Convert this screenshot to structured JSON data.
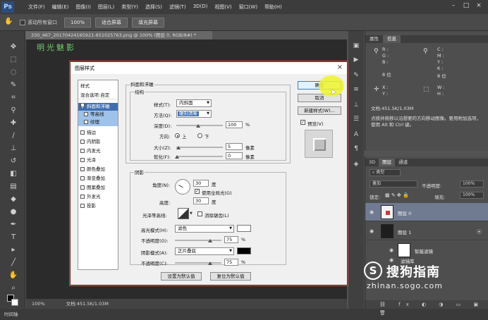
{
  "app": {
    "logo": "Ps"
  },
  "menus": [
    "文件(F)",
    "编辑(E)",
    "图像(I)",
    "图层(L)",
    "类型(Y)",
    "选择(S)",
    "滤镜(T)",
    "3D(D)",
    "视图(V)",
    "窗口(W)",
    "帮助(H)"
  ],
  "options_bar": {
    "scroll_all": "滚动所有窗口",
    "zoom_100": "100%",
    "fit_screen": "适合屏幕",
    "fill_screen": "填充屏幕"
  },
  "document": {
    "tab_title": "330_467_20170424165921-651025763.png @ 100% (图层 0, RGB/8#) *",
    "canvas_text": "明光魅影",
    "zoom": "100%",
    "doc_info": "文档:451.5K/1.03M"
  },
  "bottom": {
    "timeline": "时间轴"
  },
  "info_panel": {
    "tabs": [
      "属性",
      "信息"
    ],
    "r": "R :",
    "g": "G :",
    "b": "B :",
    "c": "C :",
    "m": "M :",
    "y": "Y :",
    "k": "K :",
    "bits_left": "8 位",
    "bits_right": "8 位",
    "x": "X :",
    "y_coord": "Y :",
    "w": "W :",
    "h": "H :",
    "doc_info": "文档:451.5K/1.03M",
    "hint": "点按并拖移以沿想要的方向移动图像。要用附加选项，使用 Alt 和 Ctrl 键。"
  },
  "layers_panel": {
    "tabs": [
      "3D",
      "图层",
      "通道"
    ],
    "kind": "类型",
    "blend_mode": "叠加",
    "opacity_label": "不透明度:",
    "opacity": "100%",
    "lock_label": "锁定:",
    "fill_label": "填充:",
    "fill": "100%",
    "layers": [
      "图层 0",
      "图层 1",
      "智能滤镜",
      "滤镜库"
    ]
  },
  "watermark": {
    "brand": "搜狗指南",
    "url": "zhinan.sogo.com"
  },
  "dialog": {
    "title": "图层样式",
    "close": "×",
    "style_list": {
      "header": "样式",
      "blend_options": "混合选项:自定",
      "items": [
        "斜面和浮雕",
        "等高线",
        "纹理",
        "描边",
        "内阴影",
        "内发光",
        "光泽",
        "颜色叠加",
        "渐变叠加",
        "图案叠加",
        "外发光",
        "投影"
      ]
    },
    "bevel": {
      "section": "斜面和浮雕",
      "structure": "结构",
      "style_label": "样式(T):",
      "style_value": "内斜面",
      "technique_label": "方法(Q):",
      "technique_value": "雕刻清晰",
      "depth_label": "深度(D):",
      "depth_value": "100",
      "depth_unit": "%",
      "direction_label": "方向:",
      "direction_up": "上",
      "direction_down": "下",
      "size_label": "大小(Z):",
      "size_value": "5",
      "size_unit": "像素",
      "soften_label": "软化(F):",
      "soften_value": "0",
      "soften_unit": "像素"
    },
    "shading": {
      "section": "阴影",
      "angle_label": "角度(N):",
      "angle_value": "30",
      "angle_unit": "度",
      "global_light": "使用全局光(G)",
      "altitude_label": "高度:",
      "altitude_value": "30",
      "altitude_unit": "度",
      "gloss_label": "光泽等高线:",
      "anti_alias": "消除锯齿(L)",
      "highlight_mode_label": "高光模式(H):",
      "highlight_mode_value": "滤色",
      "highlight_opacity_label": "不透明度(O):",
      "highlight_opacity": "75",
      "shadow_mode_label": "阴影模式(A):",
      "shadow_mode_value": "正片叠底",
      "shadow_opacity_label": "不透明度(C):",
      "shadow_opacity": "75",
      "pct": "%"
    },
    "buttons": {
      "set_default": "设置为默认值",
      "reset_default": "复位为默认值",
      "ok": "确定",
      "cancel": "取消",
      "new_style": "新建样式(W)...",
      "preview": "预览(V)"
    }
  },
  "colors": {
    "accent": "#3f6fb0",
    "highlight": "#f0f528",
    "active_layer": "#707a91"
  }
}
